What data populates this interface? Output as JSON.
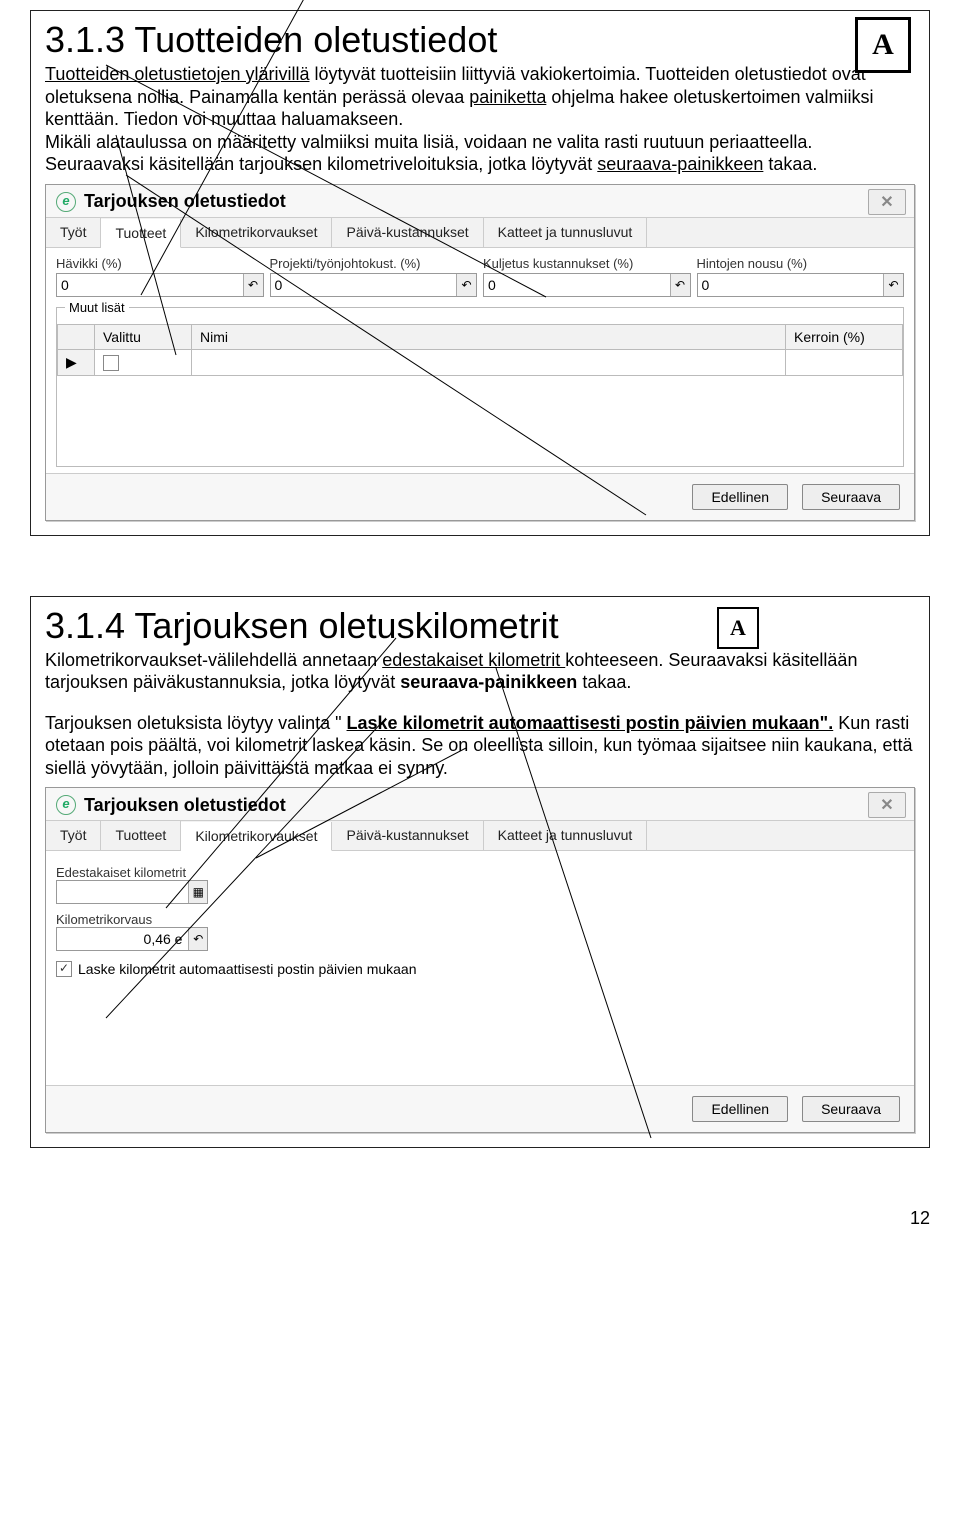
{
  "section1": {
    "heading": "3.1.3 Tuotteiden oletustiedot",
    "p1a": "Tuotteiden oletustietojen ylärivillä",
    "p1b": " löytyvät tuotteisiin liittyviä vakiokertoimia. Tuotteiden oletustiedot ovat oletuksena nollia. Painamalla kentän perässä olevaa ",
    "p1c": "painiketta",
    "p1d": " ohjelma hakee oletuskertoimen valmiiksi kenttään. Tiedon voi muuttaa haluamakseen.",
    "p2": "Mikäli alataulussa on määritetty valmiiksi muita lisiä, voidaan ne valita rasti ruutuun periaatteella.",
    "p3a": "Seuraavaksi käsitellään tarjouksen kilometriveloituksia, jotka löytyvät ",
    "p3b": "seuraava-painikkeen",
    "p3c": " takaa.",
    "dialog": {
      "title": "Tarjouksen oletustiedot",
      "tabs": [
        "Työt",
        "Tuotteet",
        "Kilometrikorvaukset",
        "Päivä-kustannukset",
        "Katteet ja tunnusluvut"
      ],
      "active_tab": 1,
      "labels": [
        "Hävikki (%)",
        "Projekti/työnjohtokust. (%)",
        "Kuljetus kustannukset (%)",
        "Hintojen nousu (%)"
      ],
      "values": [
        "0",
        "0",
        "0",
        "0"
      ],
      "group_title": "Muut lisät",
      "col_valittu": "Valittu",
      "col_nimi": "Nimi",
      "col_kerroin": "Kerroin (%)",
      "btn_prev": "Edellinen",
      "btn_next": "Seuraava"
    }
  },
  "section2": {
    "heading": "3.1.4  Tarjouksen oletuskilometrit",
    "p1a": "Kilometrikorvaukset-välilehdellä annetaan ",
    "p1b": "edestakaiset kilometrit ",
    "p1c": "kohteeseen. Seuraavaksi käsitellään tarjouksen päiväkustannuksia, jotka löytyvät ",
    "p1d": "seuraava-painikkeen",
    "p1e": " takaa.",
    "p2a": "Tarjouksen oletuksista löytyy valinta \" ",
    "p2b": "Laske kilometrit automaattisesti postin päivien mukaan\".",
    "p2c": " Kun rasti otetaan pois päältä, voi kilometrit laskea käsin. Se on oleellista silloin, kun työmaa sijaitsee niin kaukana, että siellä yövytään, jolloin päivittäistä matkaa ei synny.",
    "dialog": {
      "title": "Tarjouksen oletustiedot",
      "tabs": [
        "Työt",
        "Tuotteet",
        "Kilometrikorvaukset",
        "Päivä-kustannukset",
        "Katteet ja tunnusluvut"
      ],
      "active_tab": 2,
      "lbl_edest": "Edestakaiset kilometrit",
      "val_edest": "",
      "lbl_korv": "Kilometrikorvaus",
      "val_korv": "0,46 e",
      "cb_label": "Laske kilometrit automaattisesti postin päivien mukaan",
      "cb_checked": true,
      "btn_prev": "Edellinen",
      "btn_next": "Seuraava"
    }
  },
  "page_number": "12",
  "logo_a": "A"
}
